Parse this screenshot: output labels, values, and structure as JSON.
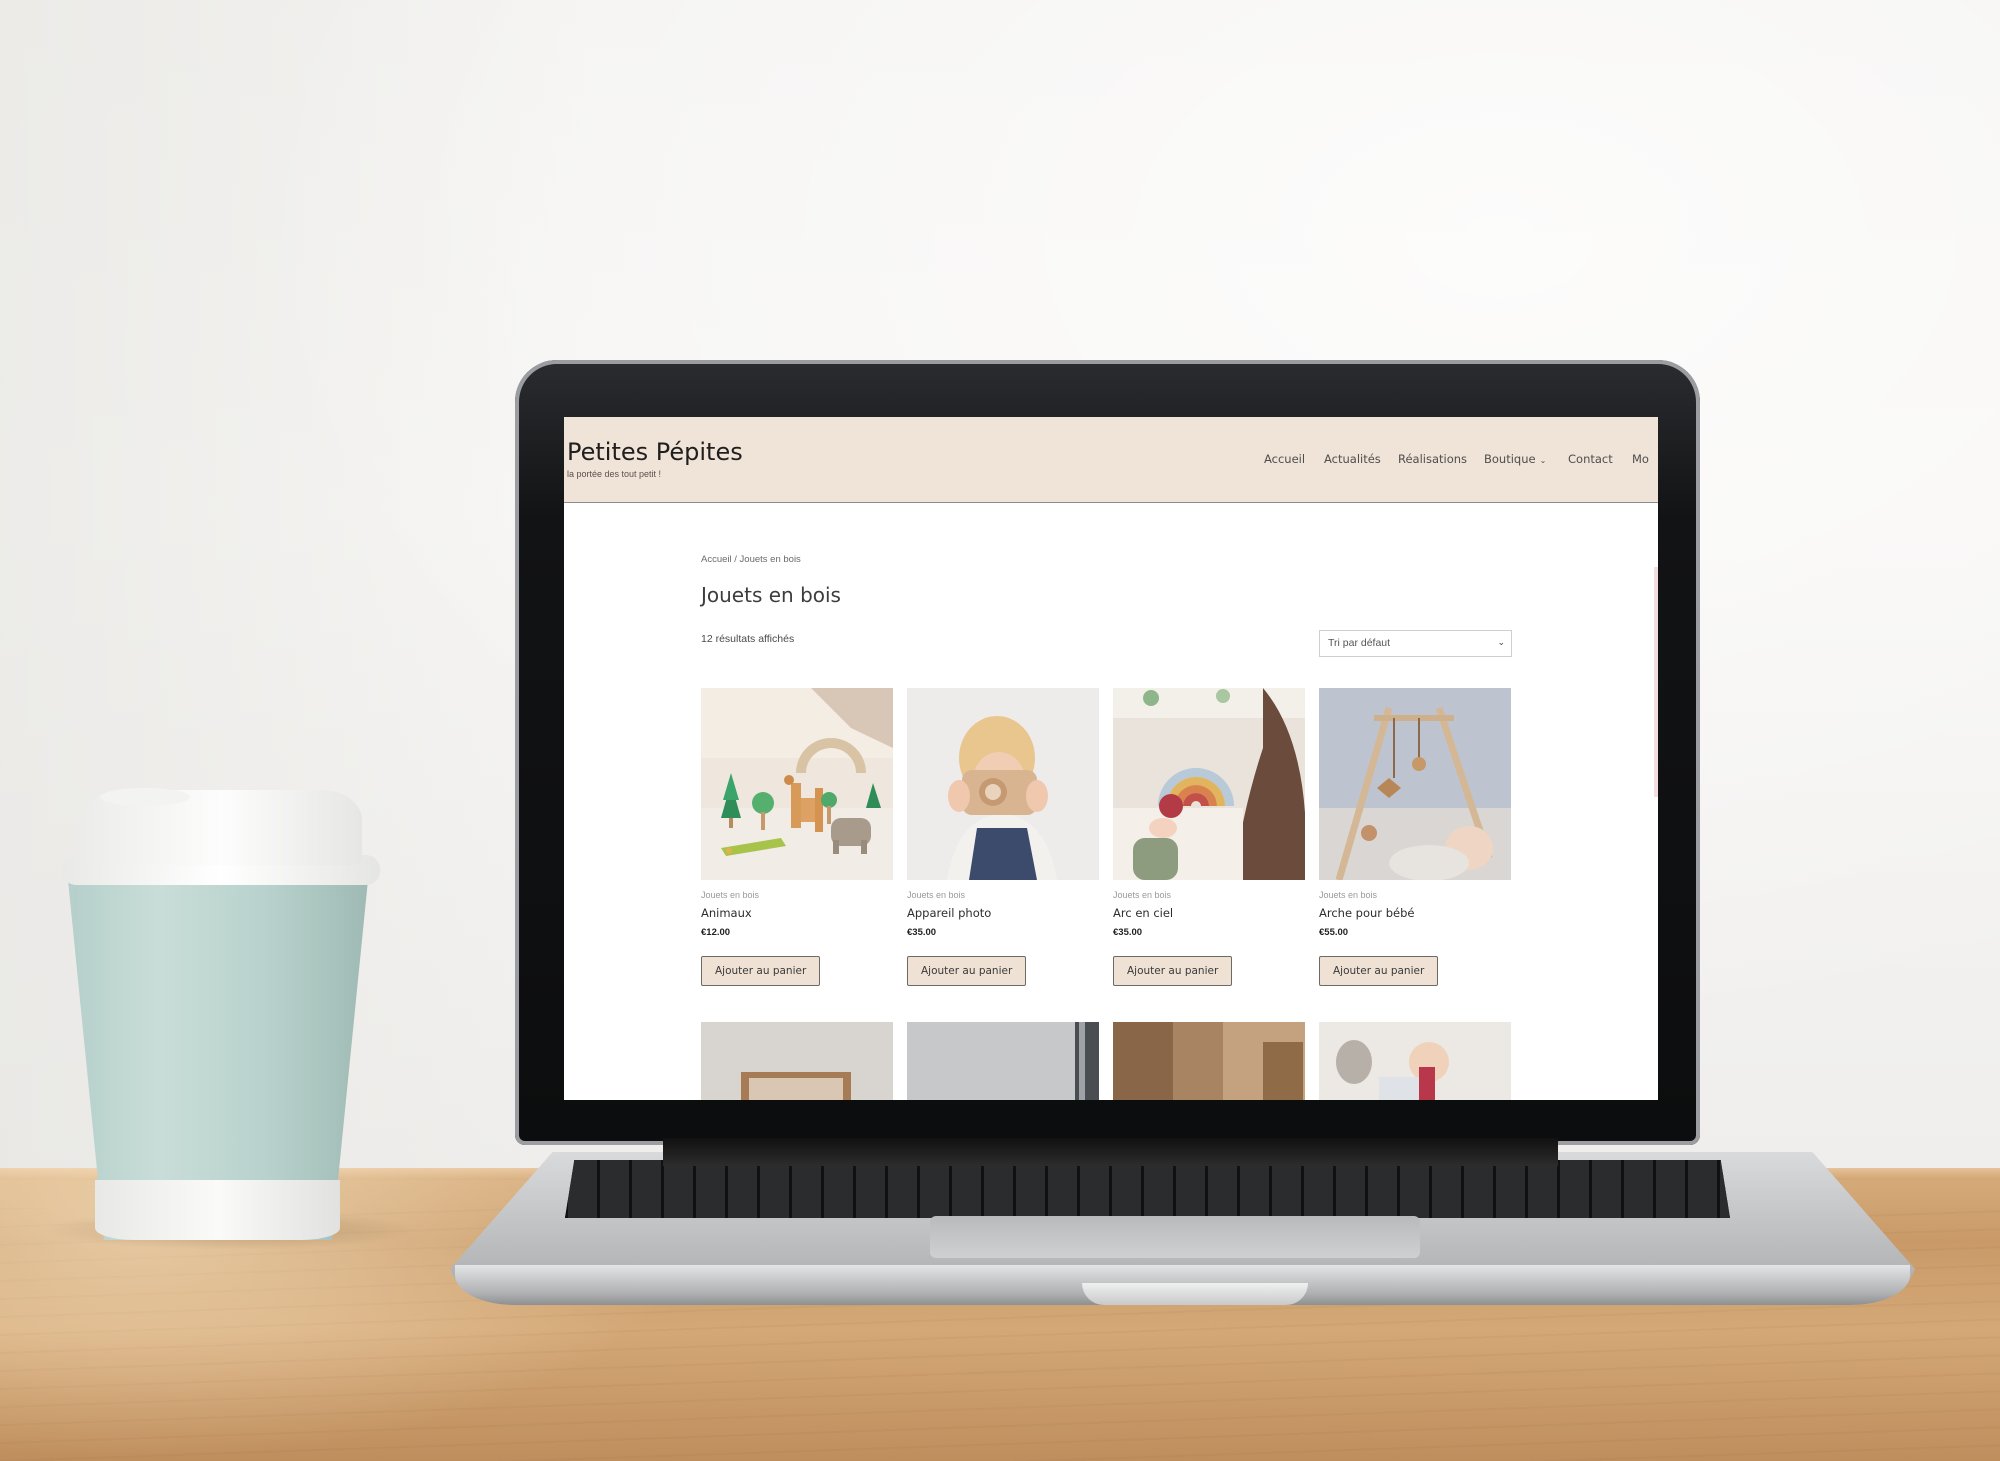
{
  "site": {
    "title": "Petites Pépites",
    "tagline": "la portée des tout petit !"
  },
  "nav": {
    "items": [
      {
        "label": "Accueil"
      },
      {
        "label": "Actualités"
      },
      {
        "label": "Réalisations"
      },
      {
        "label": "Boutique",
        "has_dropdown": true
      },
      {
        "label": "Contact"
      },
      {
        "label": "Mo"
      }
    ]
  },
  "breadcrumb": {
    "home": "Accueil",
    "separator": " / ",
    "current": "Jouets en bois"
  },
  "page": {
    "title": "Jouets en bois",
    "result_count": "12 résultats affichés",
    "sort_selected": "Tri par défaut"
  },
  "products": [
    {
      "category": "Jouets en bois",
      "name": "Animaux",
      "price": "€12.00",
      "button": "Ajouter au panier",
      "image": "wooden-animals-image"
    },
    {
      "category": "Jouets en bois",
      "name": "Appareil photo",
      "price": "€35.00",
      "button": "Ajouter au panier",
      "image": "child-wooden-camera-image"
    },
    {
      "category": "Jouets en bois",
      "name": "Arc en ciel",
      "price": "€35.00",
      "button": "Ajouter au panier",
      "image": "wooden-rainbow-image"
    },
    {
      "category": "Jouets en bois",
      "name": "Arche pour bébé",
      "price": "€55.00",
      "button": "Ajouter au panier",
      "image": "baby-play-arch-image"
    }
  ],
  "colors": {
    "header_bg": "#f0e3d7",
    "button_bg": "#efe2d5",
    "cup": "#b9d2cd"
  }
}
